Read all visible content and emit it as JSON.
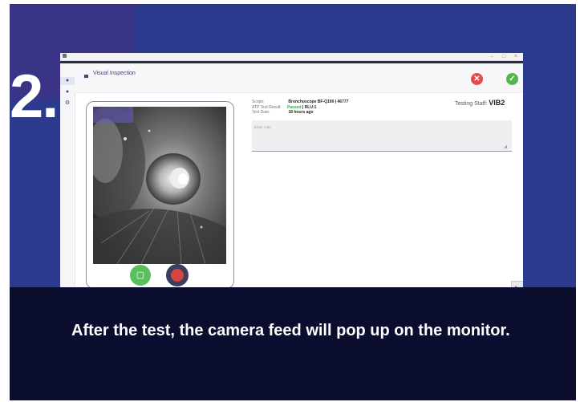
{
  "slide": {
    "step_number": "2.",
    "caption": "After the test, the camera feed will pop up on the monitor."
  },
  "app": {
    "window_controls": [
      "–",
      "□",
      "×"
    ],
    "rail_icons": [
      "home-icon",
      "circle-icon",
      "gear-icon"
    ],
    "header": {
      "icon": "camera-icon",
      "title": "Visual Inspection"
    },
    "cancel_icon": "✕",
    "confirm_icon": "✓",
    "details": {
      "scope_label": "Scope:",
      "scope_value": "Bronchoscope BF-Q190 | 46777",
      "atp_label": "ATP Test Result:",
      "atp_status": "Passed",
      "atp_rlu": " | RLU:1",
      "date_label": "Test Date:",
      "date_value": "18 hours ago"
    },
    "staff": {
      "label": "Testing Staff:",
      "id": "VIB2"
    },
    "note": {
      "placeholder": "Enter note"
    },
    "snapshot_icon": "▢",
    "chat_icon": "◣"
  },
  "colors": {
    "slide_bg": "#2b3a8c",
    "caption_bg": "#0b0d2e",
    "cancel": "#e54a44",
    "confirm": "#52b64a",
    "record": "#d6453f",
    "snapshot": "#5bbf5d"
  }
}
